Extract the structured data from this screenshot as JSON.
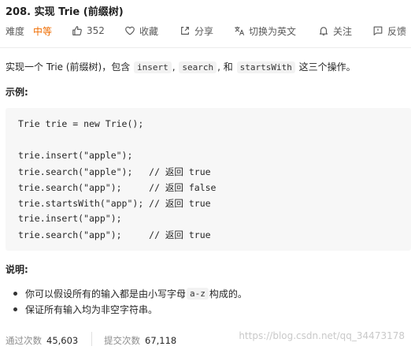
{
  "problem": {
    "title": "208. 实现 Trie (前缀树)"
  },
  "toolbar": {
    "difficulty_label": "难度",
    "difficulty_value": "中等",
    "likes": "352",
    "favorite": "收藏",
    "share": "分享",
    "switch_lang": "切换为英文",
    "follow": "关注",
    "feedback": "反馈"
  },
  "description": {
    "part1": "实现一个 Trie (前缀树)，包含 ",
    "code1": "insert",
    "sep1": ", ",
    "code2": "search",
    "sep2": ", 和 ",
    "code3": "startsWith",
    "part2": " 这三个操作。"
  },
  "example": {
    "heading": "示例:",
    "lines": [
      "Trie trie = new Trie();",
      "",
      "trie.insert(\"apple\");",
      "trie.search(\"apple\");   // 返回 true",
      "trie.search(\"app\");     // 返回 false",
      "trie.startsWith(\"app\"); // 返回 true",
      "trie.insert(\"app\");",
      "trie.search(\"app\");     // 返回 true"
    ]
  },
  "notes": {
    "heading": "说明:",
    "item1_pre": "你可以假设所有的输入都是由小写字母 ",
    "item1_code": "a-z",
    "item1_post": " 构成的。",
    "item2": "保证所有输入均为非空字符串。"
  },
  "stats": {
    "accepted_label": "通过次数",
    "accepted_value": "45,603",
    "submitted_label": "提交次数",
    "submitted_value": "67,118"
  },
  "watermark": "https://blog.csdn.net/qq_34473178",
  "colors": {
    "difficulty_medium": "#ef6c00",
    "code_background": "#f7f7f7"
  }
}
